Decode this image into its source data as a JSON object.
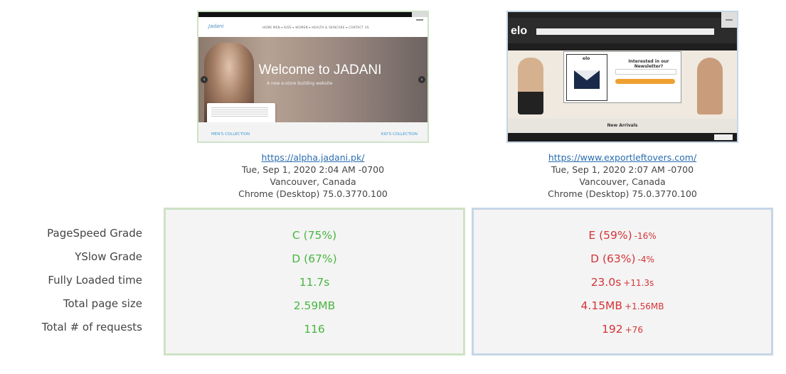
{
  "left": {
    "url": "https://alpha.jadani.pk/",
    "date": "Tue, Sep 1, 2020 2:04 AM -0700",
    "location": "Vancouver, Canada",
    "browser": "Chrome (Desktop) 75.0.3770.100",
    "thumb": {
      "logo": "Jadani",
      "menu": "HOME   MEN ▾   KIDS ▾   WOMEN ▾   HEALTH & SKINCARE ▾   CONTACT US",
      "hero_title": "Welcome to JADANI",
      "hero_sub": "A new e-store building website",
      "bottom_left": "MEN'S COLLECTION",
      "bottom_right": "KID'S COLLECTION"
    },
    "metrics": {
      "pagespeed": "C (75%)",
      "yslow": "D (67%)",
      "loaded": "11.7s",
      "size": "2.59MB",
      "requests": "116"
    }
  },
  "right": {
    "url": "https://www.exportleftovers.com/",
    "date": "Tue, Sep 1, 2020 2:07 AM -0700",
    "location": "Vancouver, Canada",
    "browser": "Chrome (Desktop) 75.0.3770.100",
    "thumb": {
      "logo": "elo",
      "modal_brand": "elo",
      "modal_title": "Interested in our Newsletter?",
      "new_arrivals": "New Arrivals"
    },
    "metrics": {
      "pagespeed": "E (59%)",
      "pagespeed_delta": "-16%",
      "yslow": "D (63%)",
      "yslow_delta": "-4%",
      "loaded": "23.0s",
      "loaded_delta": "+11.3s",
      "size": "4.15MB",
      "size_delta": "+1.56MB",
      "requests": "192",
      "requests_delta": "+76"
    }
  },
  "labels": {
    "pagespeed": "PageSpeed Grade",
    "yslow": "YSlow Grade",
    "loaded": "Fully Loaded time",
    "size": "Total page size",
    "requests": "Total # of requests"
  },
  "colors": {
    "good": "#4bb543",
    "bad": "#d6343a",
    "left_border": "#cfe2c6",
    "right_border": "#c5d6e6"
  }
}
